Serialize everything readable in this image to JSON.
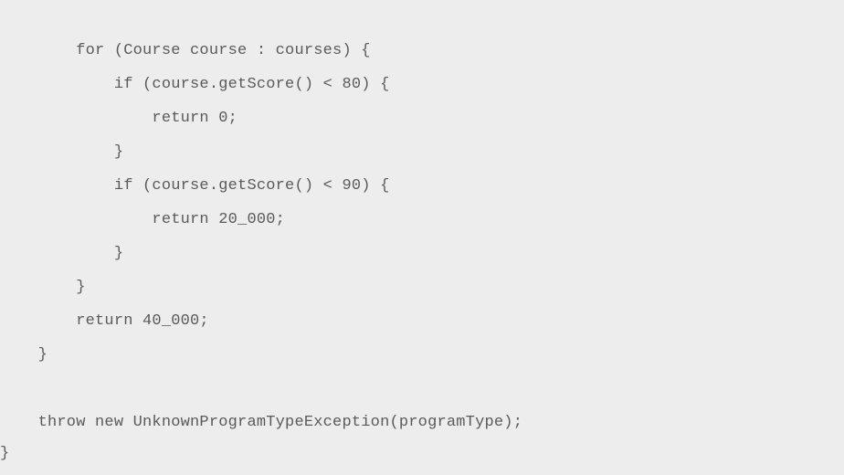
{
  "code": {
    "lines": [
      "        for (Course course : courses) {",
      "            if (course.getScore() < 80) {",
      "                return 0;",
      "            }",
      "            if (course.getScore() < 90) {",
      "                return 20_000;",
      "            }",
      "        }",
      "        return 40_000;",
      "    }",
      "",
      "    throw new UnknownProgramTypeException(programType);",
      "}"
    ]
  }
}
